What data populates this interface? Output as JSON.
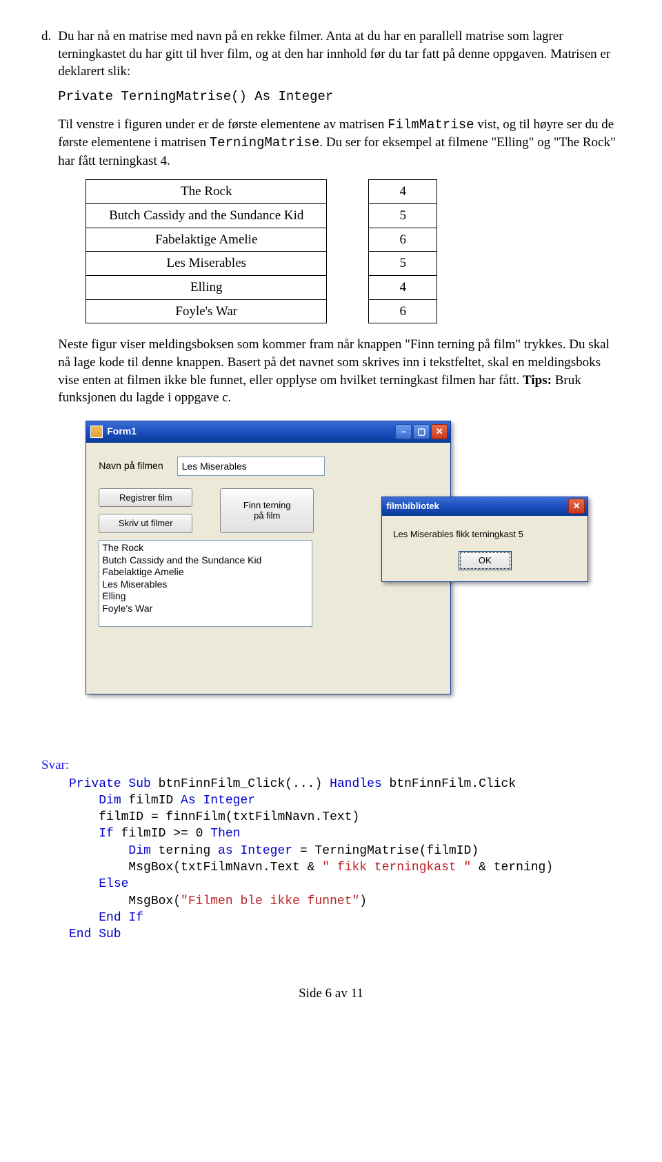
{
  "question": {
    "label": "d.",
    "text": "Du har nå en matrise med navn på en rekke filmer. Anta at du har en parallell matrise som lagrer terningkastet du har gitt til hver film, og at den har innhold før du tar fatt på denne oppgaven. Matrisen er deklarert slik:"
  },
  "decl_code": "Private TerningMatrise() As Integer",
  "para2_a": "Til venstre i figuren under er de første elementene av matrisen ",
  "para2_code1": "FilmMatrise",
  "para2_b": " vist,  og til høyre ser du de første elementene i matrisen ",
  "para2_code2": "TerningMatrise",
  "para2_c": ". Du ser for eksempel at filmene \"Elling\" og \"The Rock\" har fått terningkast 4.",
  "films": [
    "The Rock",
    "Butch Cassidy and the Sundance Kid",
    "Fabelaktige Amelie",
    "Les Miserables",
    "Elling",
    "Foyle's War"
  ],
  "dice": [
    "4",
    "5",
    "6",
    "5",
    "4",
    "6"
  ],
  "para3_a": "Neste figur viser meldingsboksen som kommer fram når knappen \"Finn terning på film\" trykkes. Du skal nå lage kode til denne knappen. Basert på det navnet som skrives inn i tekstfeltet, skal en meldingsboks vise enten at filmen ikke ble funnet, eller opplyse om hvilket terningkast filmen har fått. ",
  "para3_tips_label": "Tips:",
  "para3_b": " Bruk funksjonen du lagde i oppgave c.",
  "form1": {
    "title": "Form1",
    "lbl_navn": "Navn på filmen",
    "txt_value": "Les Miserables",
    "btn_registrer": "Registrer film",
    "btn_finn_l1": "Finn terning",
    "btn_finn_l2": "på film",
    "btn_skrivut": "Skriv ut filmer",
    "listitems": [
      "The Rock",
      "Butch Cassidy and the Sundance Kid",
      "Fabelaktige Amelie",
      "Les Miserables",
      "Elling",
      "Foyle's War"
    ]
  },
  "msgbox": {
    "title": "filmbibliotek",
    "text": "Les Miserables fikk terningkast 5",
    "ok": "OK"
  },
  "svar_label": "Svar:",
  "code": {
    "l1a": "Private Sub",
    "l1b": " btnFinnFilm_Click(...) ",
    "l1c": "Handles",
    "l1d": " btnFinnFilm.Click",
    "l2a": "Dim",
    "l2b": " filmID ",
    "l2c": "As Integer",
    "l3": "filmID = finnFilm(txtFilmNavn.Text)",
    "l4a": "If",
    "l4b": " filmID >= 0 ",
    "l4c": "Then",
    "l5a": "Dim",
    "l5b": " terning ",
    "l5c": "as Integer",
    "l5d": " = TerningMatrise(filmID)",
    "l6a": "MsgBox(txtFilmNavn.Text & ",
    "l6b": "\" fikk terningkast \"",
    "l6c": " & terning)",
    "l7": "Else",
    "l8a": "MsgBox(",
    "l8b": "\"Filmen ble ikke funnet\"",
    "l8c": ")",
    "l9": "End If",
    "l10": "End Sub"
  },
  "footer": "Side 6 av 11"
}
